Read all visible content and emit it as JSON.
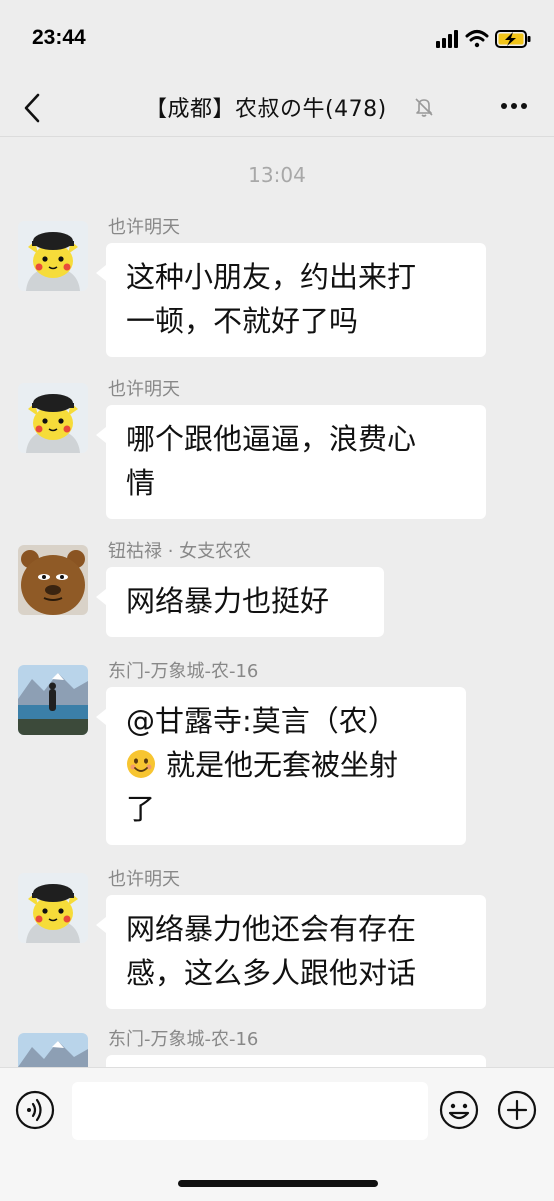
{
  "status_bar": {
    "time": "23:44",
    "icons": [
      "signal-icon",
      "wifi-icon",
      "battery-charging-icon"
    ]
  },
  "header": {
    "title": "【成都】农叔の牛(478)",
    "back_icon": "chevron-left-icon",
    "mute_icon": "bell-muted-icon",
    "more_icon": "more-dots-icon"
  },
  "chat": {
    "time_divider": "13:04",
    "messages": [
      {
        "sender": "也许明天",
        "avatar": "pikachu-cap-avatar",
        "lines": [
          "这种小朋友，约出来打",
          "一顿，不就好了吗"
        ]
      },
      {
        "sender": "也许明天",
        "avatar": "pikachu-cap-avatar",
        "lines": [
          "哪个跟他逼逼，浪费心",
          "情"
        ]
      },
      {
        "sender": "钮祜禄 · 女支农农",
        "avatar": "brown-bear-avatar",
        "lines": [
          "网络暴力也挺好"
        ]
      },
      {
        "sender": "东门-万象城-农-16",
        "avatar": "mountain-lake-photo-avatar",
        "lines": [
          "@甘露寺:莫言（农）",
          "就是他无套被坐射",
          "了"
        ],
        "emoji": "smiling-face-icon"
      },
      {
        "sender": "也许明天",
        "avatar": "pikachu-cap-avatar",
        "lines": [
          "网络暴力他还会有存在",
          "感，这么多人跟他对话"
        ]
      },
      {
        "sender": "东门-万象城-农-16",
        "avatar": "mountain-lake-photo-avatar",
        "lines": []
      }
    ]
  },
  "input_bar": {
    "placeholder": "",
    "icons": [
      "voice-icon",
      "emoji-icon",
      "plus-icon"
    ]
  }
}
